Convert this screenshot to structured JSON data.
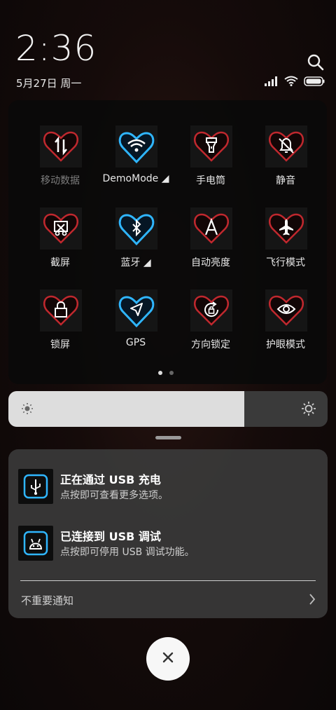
{
  "status": {
    "time": "2:36",
    "date": "5月27日 周一",
    "icons": [
      "signal-icon",
      "wifi-icon",
      "battery-icon"
    ]
  },
  "quick_settings": {
    "tiles": [
      {
        "label": "移动数据",
        "icon": "mobile-data-icon",
        "active": false
      },
      {
        "label": "DemoMode ◢",
        "icon": "wifi-icon",
        "active": true
      },
      {
        "label": "手电筒",
        "icon": "flashlight-icon",
        "active": false
      },
      {
        "label": "静音",
        "icon": "mute-bell-icon",
        "active": false
      },
      {
        "label": "截屏",
        "icon": "screenshot-icon",
        "active": false
      },
      {
        "label": "蓝牙 ◢",
        "icon": "bluetooth-icon",
        "active": true
      },
      {
        "label": "自动亮度",
        "icon": "auto-brightness-icon",
        "active": false
      },
      {
        "label": "飞行模式",
        "icon": "airplane-icon",
        "active": false
      },
      {
        "label": "锁屏",
        "icon": "lock-icon",
        "active": false
      },
      {
        "label": "GPS",
        "icon": "gps-icon",
        "active": true
      },
      {
        "label": "方向锁定",
        "icon": "rotation-lock-icon",
        "active": false
      },
      {
        "label": "护眼模式",
        "icon": "eye-icon",
        "active": false
      }
    ],
    "page_count": 2,
    "current_page": 1
  },
  "brightness": {
    "level": 0.74
  },
  "notifications": [
    {
      "title": "正在通过 USB 充电",
      "body": "点按即可查看更多选项。",
      "icon": "usb-charging-icon"
    },
    {
      "title": "已连接到 USB 调试",
      "body": "点按即可停用 USB 调试功能。",
      "icon": "usb-debug-icon"
    }
  ],
  "unimportant": {
    "label": "不重要通知"
  },
  "colors": {
    "heart_red": "#c0282e",
    "heart_blue": "#2fb6ff",
    "panel_dark": "#0a0a0a",
    "notif_bg": "#3a3a3a"
  }
}
